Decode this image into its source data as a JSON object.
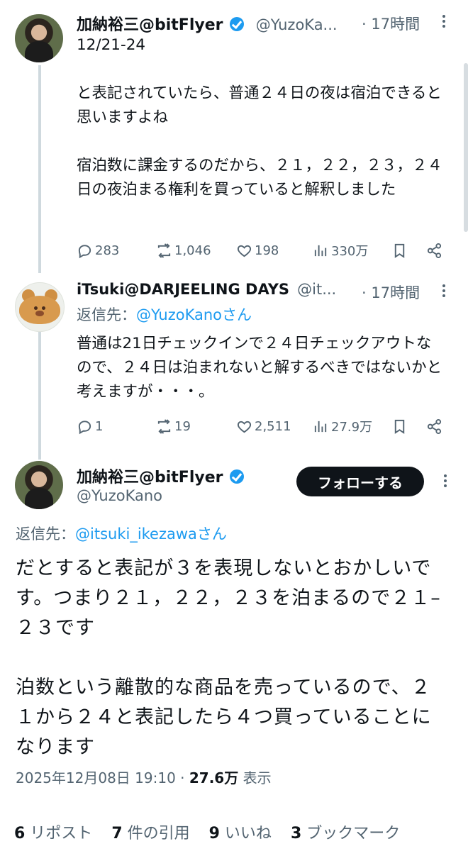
{
  "tweets": [
    {
      "name": "加納裕三@bitFlyer",
      "handle": "@YuzoKa...",
      "time": "· 17時間",
      "text": "12/21-24\n\nと表記されていたら、普通２４日の夜は宿泊できると思いますよね\n\n宿泊数に課金するのだから、２１，２２，２３，２４日の夜泊まる権利を買っていると解釈しました",
      "stats": {
        "replies": "283",
        "reposts": "1,046",
        "likes": "198",
        "views": "330万"
      }
    },
    {
      "name": "iTsuki@DARJEELING DAYS",
      "handle": "@it...",
      "time": "· 17時間",
      "reply_prefix": "返信先：",
      "reply_to": "@YuzoKanoさん",
      "text": "普通は21日チェックインで２４日チェックアウトなので、２４日は泊まれないと解するべきではないかと考えますが・・・。",
      "stats": {
        "replies": "1",
        "reposts": "19",
        "likes": "2,511",
        "views": "27.9万"
      }
    }
  ],
  "main_tweet": {
    "name": "加納裕三@bitFlyer",
    "handle": "@YuzoKano",
    "follow_label": "フォローする",
    "reply_prefix": "返信先：",
    "reply_to": "@itsuki_ikezawaさん",
    "text": "だとすると表記が３を表現しないとおかしいです。つまり２１，２２，２３を泊まるので２１–２３です\n\n泊数という離散的な商品を売っているので、２１から２４と表記したら４つ買っていることになります",
    "timestamp": "2025年12月08日 19:10 · ",
    "views_count": "27.6万",
    "views_label": " 表示",
    "footer": {
      "reposts_count": "6",
      "reposts_label": " リポスト",
      "quotes_count": "7",
      "quotes_label": " 件の引用",
      "likes_count": "9",
      "likes_label": " いいね",
      "bookmarks_count": "3",
      "bookmarks_label": " ブックマーク"
    }
  },
  "icons": [
    "reply-icon",
    "repost-icon",
    "like-icon",
    "views-icon",
    "bookmark-icon",
    "share-icon",
    "more-icon",
    "verified-badge-icon"
  ],
  "colors": {
    "accent": "#1d9bf0",
    "text": "#0f1419",
    "muted": "#536471",
    "thread_line": "#cfd9de"
  }
}
